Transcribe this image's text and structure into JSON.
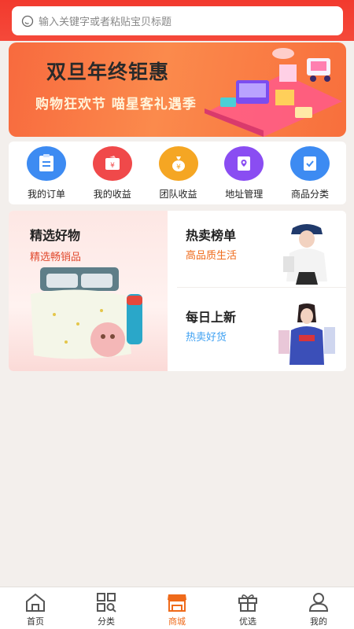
{
  "search": {
    "placeholder": "输入关键字或者粘贴宝贝标题"
  },
  "banner": {
    "title": "双旦年终钜惠",
    "subtitle": "购物狂欢节  喵星客礼遇季"
  },
  "menu": [
    {
      "label": "我的订单",
      "icon": "order-icon",
      "color": "#3d8bf2"
    },
    {
      "label": "我的收益",
      "icon": "income-icon",
      "color": "#f0494a"
    },
    {
      "label": "团队收益",
      "icon": "team-income-icon",
      "color": "#f5a623"
    },
    {
      "label": "地址管理",
      "icon": "address-icon",
      "color": "#8a4df2"
    },
    {
      "label": "商品分类",
      "icon": "category-icon",
      "color": "#3d8bf2"
    }
  ],
  "promo": {
    "featured": {
      "title": "精选好物",
      "subtitle": "精选畅销品",
      "subtitle_color": "#e14a2e"
    },
    "hot": {
      "title": "热卖榜单",
      "subtitle": "高品质生活",
      "subtitle_color": "#ef6a1a"
    },
    "daily": {
      "title": "每日上新",
      "subtitle": "热卖好货",
      "subtitle_color": "#3da0f2"
    }
  },
  "tabs": [
    {
      "label": "首页",
      "icon": "home-icon",
      "active": false
    },
    {
      "label": "分类",
      "icon": "grid-search-icon",
      "active": false
    },
    {
      "label": "商城",
      "icon": "store-icon",
      "active": true
    },
    {
      "label": "优选",
      "icon": "gift-icon",
      "active": false
    },
    {
      "label": "我的",
      "icon": "user-icon",
      "active": false
    }
  ],
  "colors": {
    "brand_red": "#f23a2e",
    "active_tab": "#ef6a1a",
    "page_bg": "#f3efec"
  }
}
